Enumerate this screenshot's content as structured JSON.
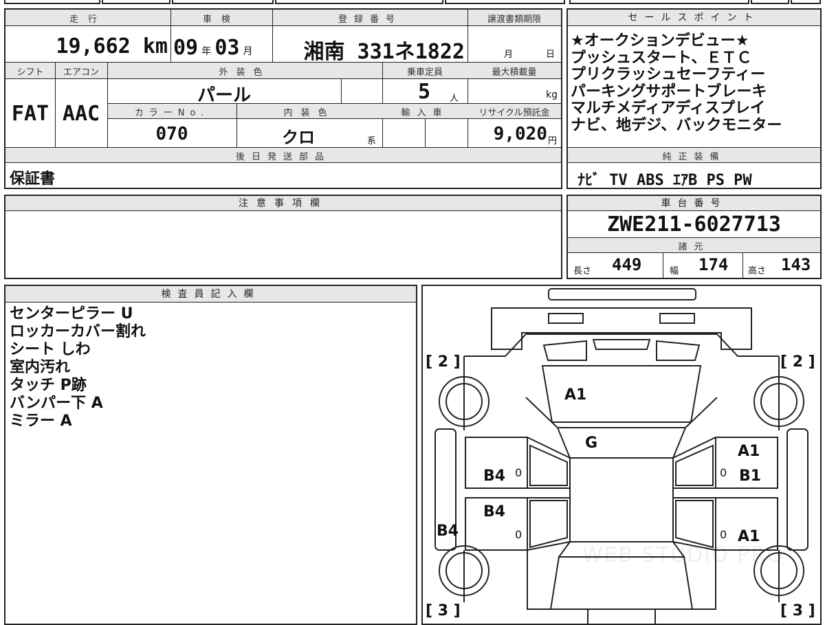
{
  "header": {
    "mileage": "走行",
    "inspection": "車検",
    "registration": "登録番号",
    "transfer_deadline": "譲渡書類期限",
    "sales_point": "セールスポイント",
    "shift": "シフト",
    "aircon": "エアコン",
    "exterior_color": "外装色",
    "capacity": "乗車定員",
    "max_load": "最大積載量",
    "color_no": "カラーNo.",
    "interior_color": "内装色",
    "import": "輸入車",
    "recycle_fee": "リサイクル預託金",
    "later_parts": "後日発送部品",
    "genuine_equipment": "純正装備",
    "notes": "注意事項欄",
    "chassis_no": "車台番号",
    "specs": "諸元",
    "inspector_notes": "検査員記入欄"
  },
  "values": {
    "mileage": "19,662 km",
    "inspection_year": "09",
    "inspection_year_unit": "年",
    "inspection_month": "03",
    "inspection_month_unit": "月",
    "plate": "湘南 331ネ1822",
    "deadline_month": "月",
    "deadline_day": "日",
    "shift": "FAT",
    "aircon": "AAC",
    "exterior_color": "パール",
    "capacity": "5",
    "capacity_unit": "人",
    "max_load_unit": "kg",
    "color_no": "070",
    "interior_color": "クロ",
    "interior_suffix": "系",
    "recycle_fee": "9,020",
    "recycle_unit": "円",
    "later_parts": "保証書",
    "genuine_equipment": "ﾅﾋﾞ TV ABS ｴｱB PS PW",
    "chassis_no": "ZWE211-6027713",
    "length_label": "長さ",
    "length": "449",
    "width_label": "幅",
    "width": "174",
    "height_label": "高さ",
    "height": "143"
  },
  "sales_points": [
    "★オークションデビュー★",
    "プッシュスタート、ＥＴＣ",
    "プリクラッシュセーフティー",
    "パーキングサポートブレーキ",
    "マルチメディアディスプレイ",
    "ナビ、地デジ、バックモニター"
  ],
  "inspector_notes": [
    "センターピラー U",
    "ロッカーカバー割れ",
    "シート しわ",
    "室内汚れ",
    "タッチ P跡",
    "バンパー下 A",
    "ミラー A"
  ],
  "diagram": {
    "tire_fl": "[ 2 ]",
    "tire_fr": "[ 2 ]",
    "tire_rl": "[ 3 ]",
    "tire_rr": "[ 3 ]",
    "hood": "A1",
    "windshield": "G",
    "fender_r": "A1",
    "door_fr": "B1",
    "door_fl": "B4",
    "door_rl": "B4",
    "rocker_l": "B4",
    "door_rr": "A1",
    "zero_fl": "0",
    "zero_rl": "0",
    "zero_fr": "0",
    "zero_rr": "0",
    "watermark": "WEB STUDIO PRO"
  }
}
